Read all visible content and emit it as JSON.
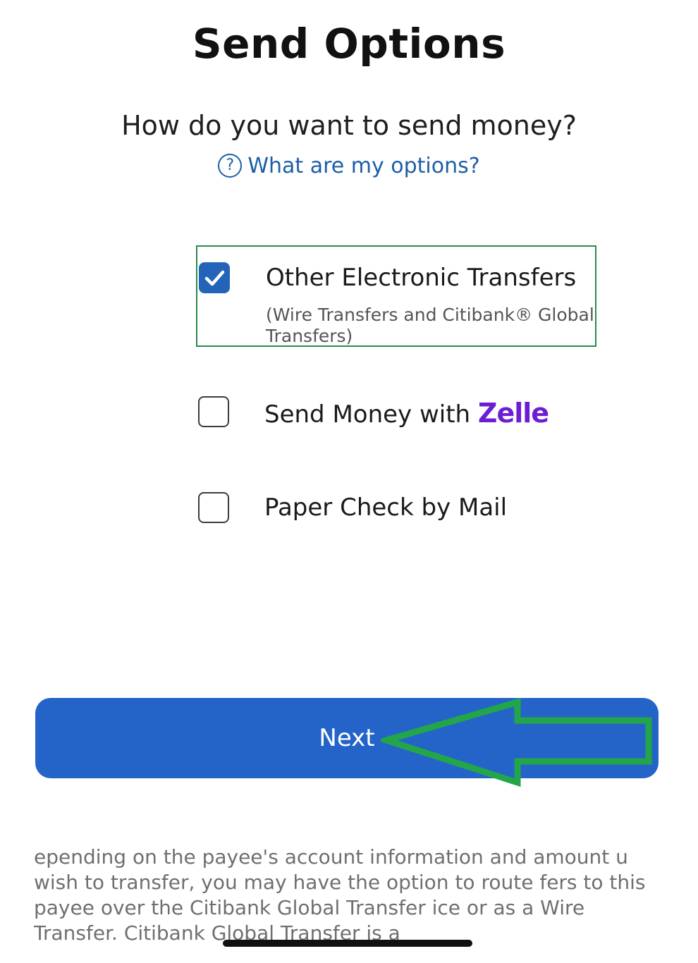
{
  "page": {
    "title": "Send Options",
    "question": "How do you want to send money?",
    "help_link_label": "What are my options?",
    "help_icon": "question-circle-icon"
  },
  "options": [
    {
      "label": "Other Electronic Transfers",
      "sublabel": "(Wire Transfers and Citibank® Global Transfers)",
      "checked": true
    },
    {
      "label": "Send Money with",
      "brand": "Zelle",
      "checked": false
    },
    {
      "label": "Paper Check by Mail",
      "checked": false
    }
  ],
  "next_button": {
    "label": "Next"
  },
  "disclaimer": "epending on the payee's account information and amount u wish to transfer, you may have the option to route fers to this payee over the Citibank Global Transfer ice or as a Wire Transfer. Citibank Global Transfer is a",
  "colors": {
    "accent": "#2464c8",
    "selected_border": "#2c8a4a",
    "link": "#1d5fa6",
    "zelle": "#6d1ed4",
    "annotation_arrow": "#23a64a"
  }
}
